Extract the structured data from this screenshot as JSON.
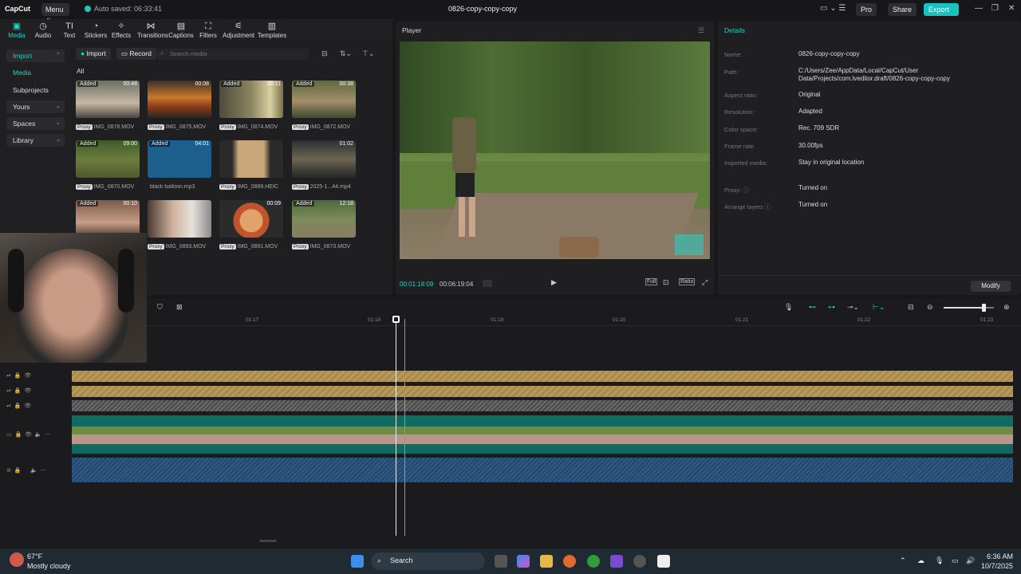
{
  "titlebar": {
    "app_logo": "CapCut",
    "menu_label": "Menu",
    "autosave_text": "Auto saved: 06:33:41",
    "title": "0826-copy-copy-copy",
    "pro_label": "Pro",
    "share_label": "Share",
    "export_label": "Export"
  },
  "toolbar": {
    "items": [
      {
        "label": "Media",
        "icon": "media-icon"
      },
      {
        "label": "Audio",
        "icon": "audio-icon"
      },
      {
        "label": "Text",
        "icon": "text-icon"
      },
      {
        "label": "Stickers",
        "icon": "stickers-icon"
      },
      {
        "label": "Effects",
        "icon": "effects-icon"
      },
      {
        "label": "Transitions",
        "icon": "transitions-icon"
      },
      {
        "label": "Captions",
        "icon": "captions-icon"
      },
      {
        "label": "Filters",
        "icon": "filters-icon"
      },
      {
        "label": "Adjustment",
        "icon": "adjustment-icon"
      },
      {
        "label": "Templates",
        "icon": "templates-icon"
      }
    ]
  },
  "sidebar": {
    "items": [
      {
        "label": "Import"
      },
      {
        "label": "Media"
      },
      {
        "label": "Subprojects"
      },
      {
        "label": "Yours"
      },
      {
        "label": "Spaces"
      },
      {
        "label": "Library"
      }
    ]
  },
  "media": {
    "import_label": "Import",
    "record_label": "Record",
    "search_placeholder": "Search media",
    "all_label": "All",
    "added_label": "Added",
    "proxy_label": "Proxy",
    "items": [
      {
        "name": "IMG_0878.MOV",
        "duration": "00:48",
        "added": true,
        "proxy": true
      },
      {
        "name": "IMG_0875.MOV",
        "duration": "00:08",
        "added": false,
        "proxy": true
      },
      {
        "name": "IMG_0874.MOV",
        "duration": "00:11",
        "added": true,
        "proxy": true
      },
      {
        "name": "IMG_0872.MOV",
        "duration": "00:38",
        "added": true,
        "proxy": true
      },
      {
        "name": "IMG_0870.MOV",
        "duration": "09:00",
        "added": true,
        "proxy": true
      },
      {
        "name": "black balloon.mp3",
        "duration": "04:01",
        "added": true,
        "proxy": false
      },
      {
        "name": "IMG_0889.HEIC",
        "duration": "",
        "added": false,
        "proxy": true
      },
      {
        "name": "2025-1...44.mp4",
        "duration": "01:02",
        "added": false,
        "proxy": true
      },
      {
        "name": "",
        "duration": "00:10",
        "added": true,
        "proxy": false
      },
      {
        "name": "IMG_0893.MOV",
        "duration": "",
        "added": false,
        "proxy": true
      },
      {
        "name": "IMG_0891.MOV",
        "duration": "00:09",
        "added": false,
        "proxy": true
      },
      {
        "name": "IMG_0873.MOV",
        "duration": "12:18",
        "added": true,
        "proxy": true
      }
    ]
  },
  "player": {
    "title": "Player",
    "current_time": "00:01:18:09",
    "total_time": "00:06:19:04",
    "full_label": "Full",
    "ratio_label": "Ratio"
  },
  "details": {
    "title": "Details",
    "rows": [
      {
        "label": "Name:",
        "value": "0826-copy-copy-copy"
      },
      {
        "label": "Path:",
        "value": "C:/Users/Zee/AppData/Local/CapCut/User Data/Projects/com.lveditor.draft/0826-copy-copy-copy"
      },
      {
        "label": "Aspect ratio:",
        "value": "Original"
      },
      {
        "label": "Resolution:",
        "value": "Adapted"
      },
      {
        "label": "Color space:",
        "value": "Rec. 709 SDR"
      },
      {
        "label": "Frame rate:",
        "value": "30.00fps"
      },
      {
        "label": "Imported media:",
        "value": "Stay in original location"
      },
      {
        "label": "Proxy:",
        "value": "Turned on"
      },
      {
        "label": "Arrange layers",
        "value": "Turned on"
      }
    ],
    "modify_label": "Modify"
  },
  "timeline": {
    "ticks": [
      "01:17",
      "01:18",
      "01:19",
      "01:20",
      "01:21",
      "01:22",
      "01:23"
    ],
    "zoom_level": 0.8
  },
  "taskbar": {
    "weather_temp": "67°F",
    "weather_desc": "Mostly cloudy",
    "search_label": "Search",
    "time": "6:36 AM",
    "date": "10/7/2025"
  },
  "colors": {
    "accent": "#1fd3c4",
    "gold_track": "#b8995a",
    "blue_track": "#2f5a86"
  }
}
